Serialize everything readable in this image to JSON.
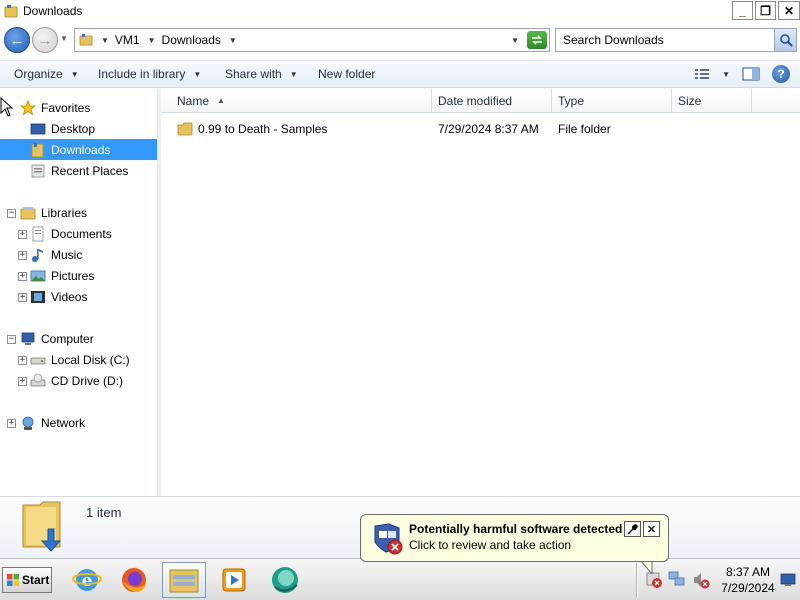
{
  "window": {
    "title": "Downloads",
    "buttons": {
      "minimize": "_",
      "maximize": "❐",
      "close": "✕"
    }
  },
  "address": {
    "back": "←",
    "forward": "→",
    "breadcrumb": [
      "VM1",
      "Downloads"
    ],
    "search_placeholder": "Search Downloads"
  },
  "toolbar": {
    "items": [
      {
        "label": "Organize",
        "has_dropdown": true
      },
      {
        "label": "Include in library",
        "has_dropdown": true
      },
      {
        "label": "Share with",
        "has_dropdown": true
      },
      {
        "label": "New folder",
        "has_dropdown": false
      }
    ],
    "help_label": "?"
  },
  "nav": {
    "favorites": {
      "label": "Favorites",
      "items": [
        "Desktop",
        "Downloads",
        "Recent Places"
      ],
      "selected": "Downloads"
    },
    "libraries": {
      "label": "Libraries",
      "items": [
        "Documents",
        "Music",
        "Pictures",
        "Videos"
      ]
    },
    "computer": {
      "label": "Computer",
      "items": [
        "Local Disk (C:)",
        "CD Drive (D:)"
      ]
    },
    "network": {
      "label": "Network"
    }
  },
  "columns": [
    "Name",
    "Date modified",
    "Type",
    "Size"
  ],
  "files": [
    {
      "name": "0.99 to Death - Samples",
      "date_modified": "7/29/2024 8:37 AM",
      "type": "File folder",
      "size": ""
    }
  ],
  "details": {
    "count": "1 item"
  },
  "taskbar": {
    "start_label": "Start",
    "apps": [
      "internet-explorer",
      "firefox",
      "windows-explorer",
      "media-player",
      "app-globe"
    ],
    "active_app": "windows-explorer",
    "clock_time": "8:37 AM",
    "clock_date": "7/29/2024"
  },
  "notification": {
    "title": "Potentially harmful software detected",
    "text": "Click to review and take action"
  }
}
